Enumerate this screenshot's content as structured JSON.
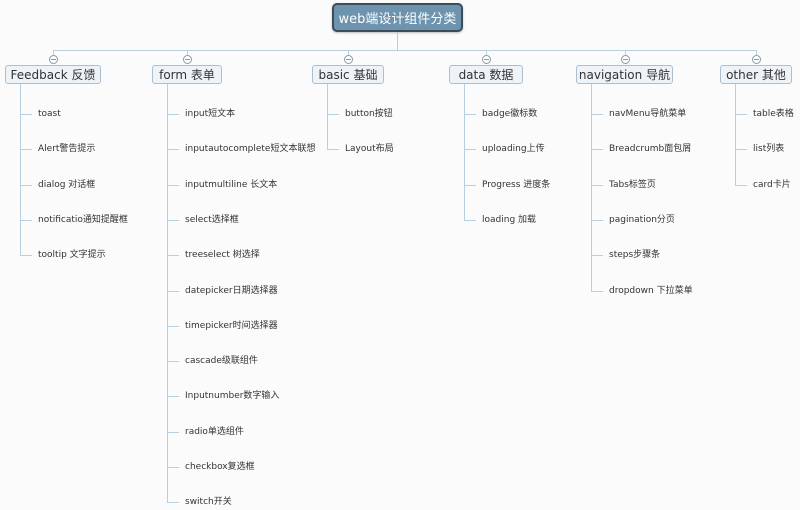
{
  "root": {
    "label": "web端设计组件分类"
  },
  "colors": {
    "root_fill": "#6d93ae",
    "root_border": "#3c4d5a",
    "branch_fill": "#eef3f8",
    "branch_border": "#a9c0d4",
    "connector": "#b8cfe0"
  },
  "branches": [
    {
      "label": "Feedback 反馈",
      "collapse_icon": "minus-circle-icon",
      "children": [
        "toast",
        "Alert警告提示",
        "dialog 对话框",
        "notificatio通知提醒框",
        "tooltip 文字提示"
      ]
    },
    {
      "label": "form 表单",
      "collapse_icon": "minus-circle-icon",
      "children": [
        "input短文本",
        "inputautocomplete短文本联想",
        "inputmultiline 长文本",
        "select选择框",
        "treeselect 树选择",
        "datepicker日期选择器",
        "timepicker时间选择器",
        "cascade级联组件",
        "Inputnumber数字输入",
        "radio单选组件",
        "checkbox复选框",
        "switch开关"
      ]
    },
    {
      "label": "basic 基础",
      "collapse_icon": "minus-circle-icon",
      "children": [
        "button按钮",
        "Layout布局"
      ]
    },
    {
      "label": "data 数据",
      "collapse_icon": "minus-circle-icon",
      "children": [
        "badge徽标数",
        "uploading上传",
        "Progress 进度条",
        "loading 加载"
      ]
    },
    {
      "label": "navigation 导航",
      "collapse_icon": "minus-circle-icon",
      "children": [
        "navMenu导航菜单",
        "Breadcrumb面包屑",
        "Tabs标签页",
        "pagination分页",
        "steps步骤条",
        "dropdown 下拉菜单"
      ]
    },
    {
      "label": "other 其他",
      "collapse_icon": "minus-circle-icon",
      "children": [
        "table表格",
        "list列表",
        "card卡片"
      ]
    }
  ]
}
